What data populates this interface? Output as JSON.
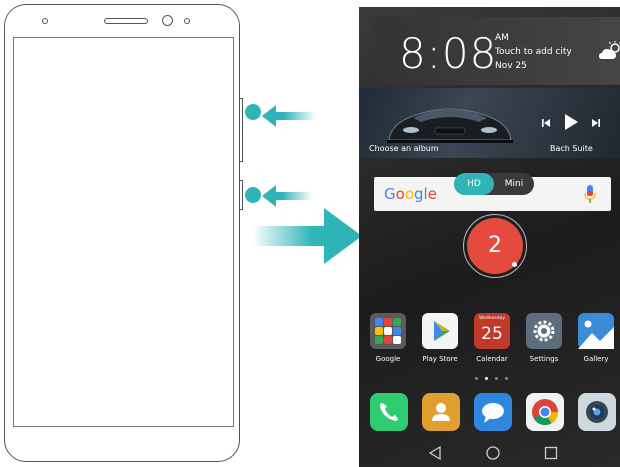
{
  "lock": {
    "time": "8:08",
    "ampm": "AM",
    "city_prompt": "Touch to add city",
    "date": "Nov 25"
  },
  "music": {
    "album_prompt": "Choose an album",
    "artist": "Bach Suite"
  },
  "search": {
    "logo": "Google",
    "toggle_hd": "HD",
    "toggle_mini": "Mini"
  },
  "countdown": "2",
  "apps": [
    {
      "label": "Google",
      "icon": "google-folder-icon"
    },
    {
      "label": "Play Store",
      "icon": "play-store-icon"
    },
    {
      "label": "Calendar",
      "icon": "calendar-icon",
      "weekday": "Wednesday",
      "day": "25"
    },
    {
      "label": "Settings",
      "icon": "settings-icon"
    },
    {
      "label": "Gallery",
      "icon": "gallery-icon"
    }
  ],
  "dock": [
    "phone-icon",
    "contacts-icon",
    "messages-icon",
    "chrome-icon",
    "camera-icon"
  ],
  "colors": {
    "accent": "#2fb5b8",
    "countdown": "#e54a3e"
  }
}
